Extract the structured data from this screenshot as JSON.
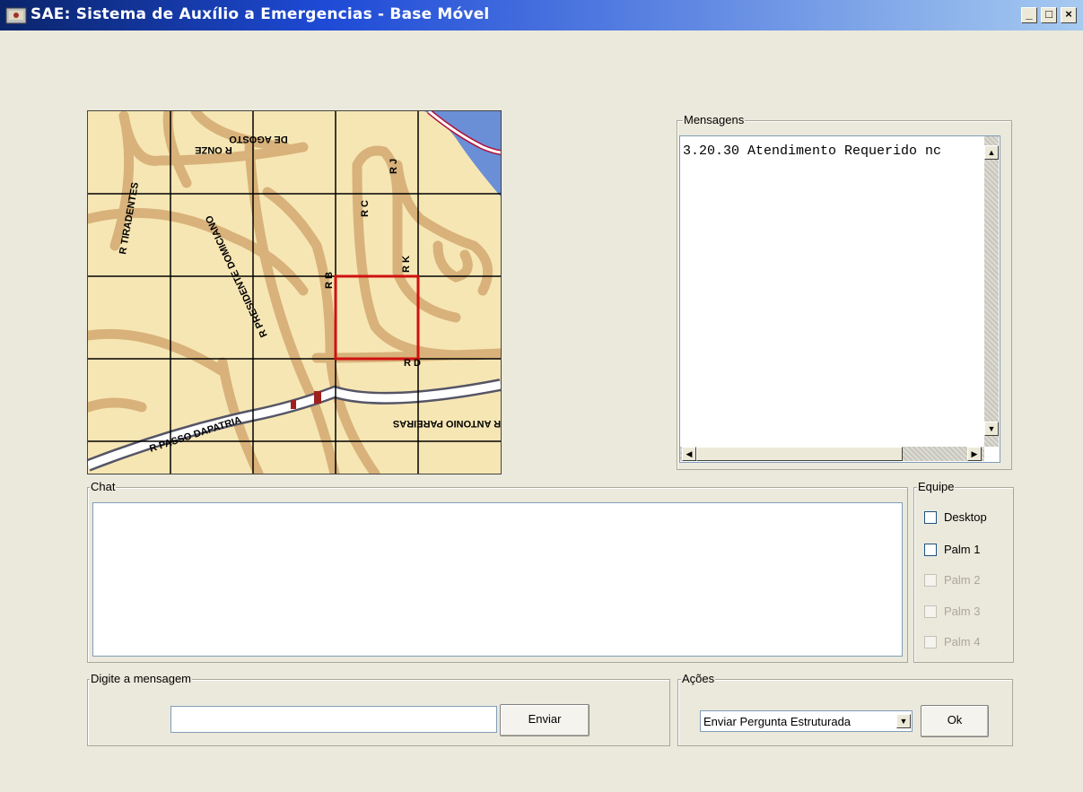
{
  "window": {
    "title": "SAE: Sistema de Auxílio a Emergencias - Base Móvel",
    "controls": [
      "_",
      "□",
      "×"
    ]
  },
  "map": {
    "streets": [
      "R ONZE DE AGOSTO",
      "R TIRADENTES",
      "R PRESIDENTE DOMICIANO",
      "R B",
      "R C",
      "R J",
      "R K",
      "R D",
      "R PASSO DAPATRIA",
      "R ANTONIO PAREIRAS"
    ]
  },
  "messages": {
    "label": "Mensagens",
    "text": "3.20.30 Atendimento Requerido nc"
  },
  "chat": {
    "label": "Chat",
    "text": ""
  },
  "team": {
    "label": "Equipe",
    "members": [
      {
        "label": "Desktop",
        "enabled": true,
        "checked": false
      },
      {
        "label": "Palm 1",
        "enabled": true,
        "checked": false
      },
      {
        "label": "Palm 2",
        "enabled": false,
        "checked": false
      },
      {
        "label": "Palm 3",
        "enabled": false,
        "checked": false
      },
      {
        "label": "Palm 4",
        "enabled": false,
        "checked": false
      }
    ]
  },
  "compose": {
    "label": "Digite a mensagem",
    "value": "",
    "send_label": "Enviar"
  },
  "actions": {
    "label": "Ações",
    "selected": "Enviar Pergunta Estruturada",
    "ok_label": "Ok"
  }
}
